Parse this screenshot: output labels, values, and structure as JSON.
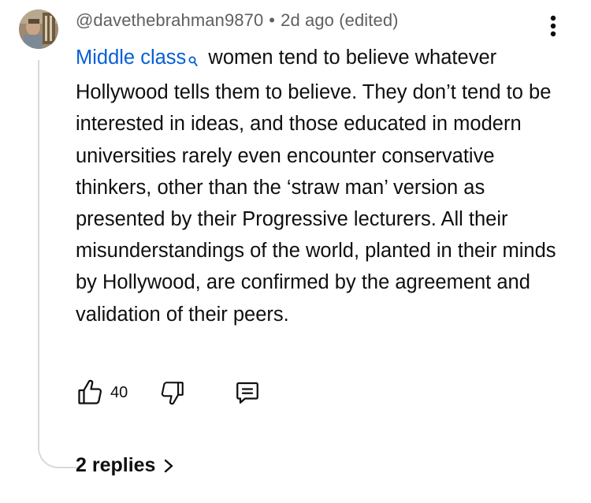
{
  "comment": {
    "author_handle": "@davethebrahman9870",
    "separator": "•",
    "timestamp": "2d ago (edited)",
    "search_link_text": "Middle class",
    "body_rest": " women tend to believe whatever Hollywood tells them to believe. They don’t tend to be interested in ideas, and those educated in modern universities rarely even encounter conservative thinkers, other than the ‘straw man’ version as presented by their Progressive lecturers. All their misunderstandings of the world, planted in their minds by Hollywood, are confirmed by the agreement and validation of their peers.",
    "like_count": "40",
    "replies_label": "2 replies"
  },
  "icons": {
    "avatar": "user-avatar-photo",
    "search": "search-icon",
    "menu": "more-vertical-icon",
    "like": "thumbs-up-icon",
    "dislike": "thumbs-down-icon",
    "reply": "reply-comment-icon",
    "replies_chevron": "chevron-right-icon"
  },
  "colors": {
    "link": "#065fd4",
    "secondary_text": "#606060",
    "primary_text": "#0f0f0f",
    "thread_line": "#d9d9d9"
  }
}
